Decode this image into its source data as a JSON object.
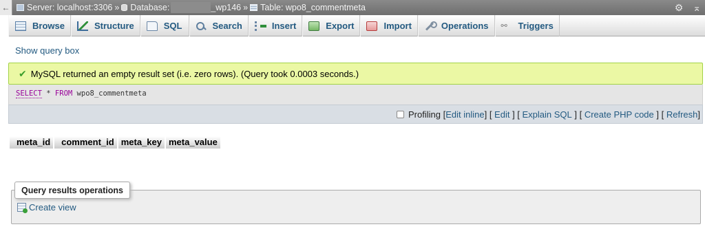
{
  "breadcrumb": {
    "back_icon": "←",
    "server_label": "Server: localhost:3306",
    "separator": "»",
    "database_label": "Database:",
    "database_suffix": "_wp146",
    "table_label": "Table: wpo8_commentmeta",
    "settings_icon": "⚙",
    "collapse_icon": "⌅"
  },
  "tabs": [
    {
      "label": "Browse"
    },
    {
      "label": "Structure"
    },
    {
      "label": "SQL"
    },
    {
      "label": "Search"
    },
    {
      "label": "Insert"
    },
    {
      "label": "Export"
    },
    {
      "label": "Import"
    },
    {
      "label": "Operations"
    },
    {
      "label": "Triggers"
    }
  ],
  "show_query_box": "Show query box",
  "message": {
    "check_icon": "✔",
    "text": "MySQL returned an empty result set (i.e. zero rows). (Query took 0.0003 seconds.)"
  },
  "sql": {
    "select": "SELECT",
    "star": "*",
    "from": "FROM",
    "table": "wpo8_commentmeta"
  },
  "actions": {
    "profiling": "Profiling",
    "edit_inline": "Edit inline",
    "edit": "Edit",
    "explain_sql": "Explain SQL",
    "create_php_code": "Create PHP code",
    "refresh": "Refresh"
  },
  "columns": [
    "meta_id",
    "comment_id",
    "meta_key",
    "meta_value"
  ],
  "query_results_operations": {
    "title": "Query results operations",
    "create_view": "Create view"
  }
}
